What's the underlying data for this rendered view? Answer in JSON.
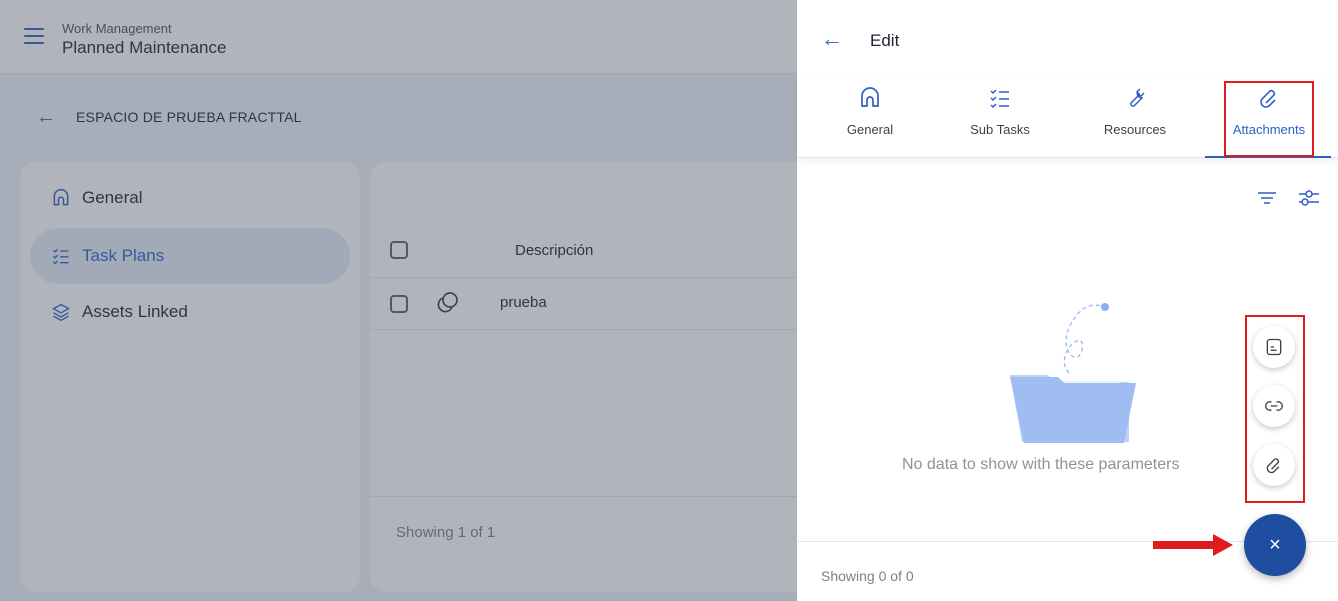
{
  "app": {
    "section": "Work Management",
    "module": "Planned Maintenance"
  },
  "breadcrumb": {
    "title": "ESPACIO DE PRUEBA FRACTTAL"
  },
  "sidebar": {
    "items": [
      {
        "label": "General",
        "icon": "home-icon",
        "active": false
      },
      {
        "label": "Task Plans",
        "icon": "checklist-icon",
        "active": true
      },
      {
        "label": "Assets Linked",
        "icon": "layers-icon",
        "active": false
      }
    ]
  },
  "table": {
    "columns": [
      "Descripción"
    ],
    "rows": [
      {
        "description": "prueba",
        "icon": "copy-icon"
      }
    ],
    "footer": "Showing 1 of 1"
  },
  "drawer": {
    "title": "Edit",
    "tabs": [
      {
        "label": "General",
        "icon": "home-icon"
      },
      {
        "label": "Sub Tasks",
        "icon": "checklist-icon"
      },
      {
        "label": "Resources",
        "icon": "wrench-icon"
      },
      {
        "label": "Attachments",
        "icon": "attach-icon",
        "active": true
      }
    ],
    "empty_message": "No data to show with these parameters",
    "footer": "Showing 0 of 0",
    "fab_close": "×",
    "mini_fabs": [
      "document-icon",
      "link-icon",
      "attach-icon"
    ]
  },
  "colors": {
    "accent": "#2d5fc8",
    "fab": "#1f4ea1",
    "highlight": "#e01b1b"
  }
}
